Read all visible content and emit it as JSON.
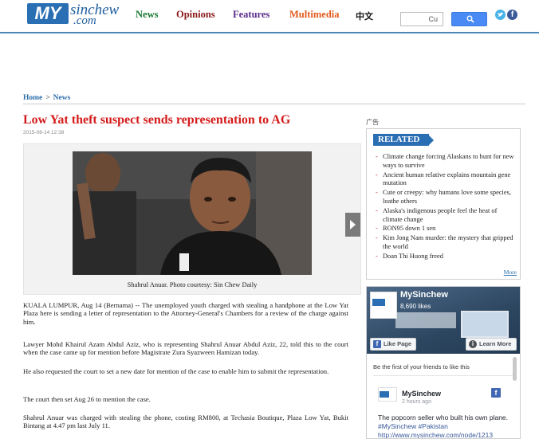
{
  "header": {
    "logo_my": "MY",
    "logo_sinchew": "sinchew",
    "logo_com": ".com",
    "nav": {
      "news": "News",
      "opinions": "Opinions",
      "features": "Features",
      "multimedia": "Multimedia",
      "chinese": "中文"
    },
    "search_value": "Cu"
  },
  "breadcrumb": {
    "home": "Home",
    "separator": ">",
    "current": "News"
  },
  "article": {
    "title": "Low Yat theft suspect sends representation to AG",
    "date": "2015-08-14 12:38",
    "caption": "Shahrul Anuar. Photo courtesy: Sin Chew Daily",
    "paragraphs": [
      "KUALA LUMPUR, Aug 14 (Bernama) -- The unemployed youth charged with stealing a handphone at the Low Yat Plaza here is sending a letter of representation to the Attorney-General's Chambers for a review of the charge against him.",
      "Lawyer Mohd Khairul Azam Abdul Aziz, who is representing Shahrul Anuar Abdul Aziz, 22, told this to the court when the case came up for mention before Magistrate Zura Syazween Hamizan today.",
      "He also requested the court to set a new date for mention of the case to enable him to submit the representation.",
      "The court then set Aug 26 to mention the case.",
      "Shahrul Anuar was charged with stealing the phone, costing RM800, at Techasia Boutique, Plaza Low Yat, Bukit Bintang at 4.47 pm last July 11."
    ]
  },
  "sidebar": {
    "ad_label": "广告",
    "related": {
      "heading": "RELATED",
      "items": [
        "Climate change forcing Alaskans to hunt for new ways to survive",
        "Ancient human relative explains mountain gene mutation",
        "Cute or creepy: why humans love some species, loathe others",
        "Alaska's indigenous people feel the heat of climate change",
        "RON95 down 1 sen",
        "Kim Jong Nam murder: the mystery that gripped the world",
        "Doan Thi Huong freed"
      ],
      "more": "More"
    },
    "facebook": {
      "page_name": "MySinchew",
      "likes": "8,690 likes",
      "like_button": "Like Page",
      "learn_button": "Learn More",
      "friends_text": "Be the first of your friends to like this",
      "post_name": "MySinchew",
      "post_time": "2 hours ago",
      "post_text": "The popcorn seller who built his own plane.",
      "post_tags": "#MySinchew #Pakistan",
      "post_link": "http://www.mysinchew.com/node/1213"
    }
  },
  "colors": {
    "title_red": "#d41b1b",
    "link_blue": "#2a6ea8",
    "brand_blue": "#2a6fb4",
    "nav_news": "#1a7a33",
    "nav_opinions": "#8b1a1a",
    "nav_features": "#5a2a8a",
    "nav_multimedia": "#e35a1c"
  }
}
